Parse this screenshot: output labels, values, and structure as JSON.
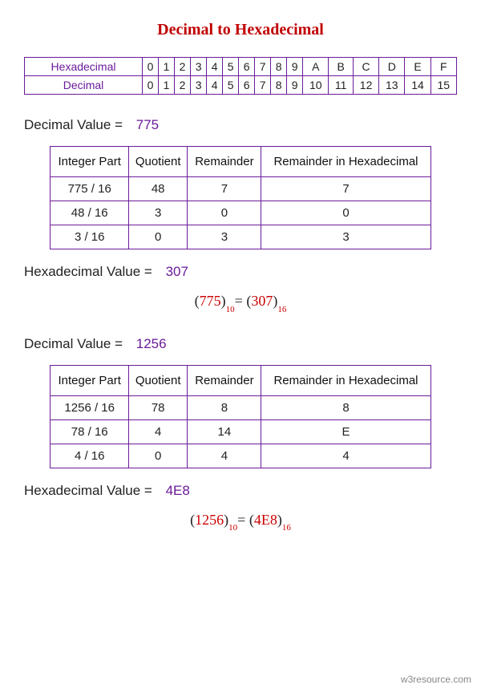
{
  "title": "Decimal to Hexadecimal",
  "ref": {
    "row1_label": "Hexadecimal",
    "row1": [
      "0",
      "1",
      "2",
      "3",
      "4",
      "5",
      "6",
      "7",
      "8",
      "9",
      "A",
      "B",
      "C",
      "D",
      "E",
      "F"
    ],
    "row2_label": "Decimal",
    "row2": [
      "0",
      "1",
      "2",
      "3",
      "4",
      "5",
      "6",
      "7",
      "8",
      "9",
      "10",
      "11",
      "12",
      "13",
      "14",
      "15"
    ]
  },
  "ex1": {
    "dec_label": "Decimal Value  =",
    "dec_value": "775",
    "headers": [
      "Integer Part",
      "Quotient",
      "Remainder",
      "Remainder  in Hexadecimal"
    ],
    "rows": [
      [
        "775 / 16",
        "48",
        "7",
        "7"
      ],
      [
        "48 / 16",
        "3",
        "0",
        "0"
      ],
      [
        "3 / 16",
        "0",
        "3",
        "3"
      ]
    ],
    "hex_label": "Hexadecimal Value  =",
    "hex_value": "307",
    "eq": {
      "dec": "775",
      "dbase": "10",
      "hex": "307",
      "hbase": "16"
    }
  },
  "ex2": {
    "dec_label": "Decimal Value  =",
    "dec_value": "1256",
    "headers": [
      "Integer Part",
      "Quotient",
      "Remainder",
      "Remainder  in Hexadecimal"
    ],
    "rows": [
      [
        "1256 / 16",
        "78",
        "8",
        "8"
      ],
      [
        "78 / 16",
        "4",
        "14",
        "E"
      ],
      [
        "4 / 16",
        "0",
        "4",
        "4"
      ]
    ],
    "hex_label": "Hexadecimal Value  =",
    "hex_value": "4E8",
    "eq": {
      "dec": "1256",
      "dbase": "10",
      "hex": "4E8",
      "hbase": "16"
    }
  },
  "footer": "w3resource.com",
  "chart_data": {
    "type": "table",
    "title": "Decimal to Hexadecimal conversion examples",
    "examples": [
      {
        "decimal": 775,
        "hexadecimal": "307",
        "steps": [
          {
            "divide": "775/16",
            "q": 48,
            "r": 7,
            "hex": "7"
          },
          {
            "divide": "48/16",
            "q": 3,
            "r": 0,
            "hex": "0"
          },
          {
            "divide": "3/16",
            "q": 0,
            "r": 3,
            "hex": "3"
          }
        ]
      },
      {
        "decimal": 1256,
        "hexadecimal": "4E8",
        "steps": [
          {
            "divide": "1256/16",
            "q": 78,
            "r": 8,
            "hex": "8"
          },
          {
            "divide": "78/16",
            "q": 4,
            "r": 14,
            "hex": "E"
          },
          {
            "divide": "4/16",
            "q": 0,
            "r": 4,
            "hex": "4"
          }
        ]
      }
    ],
    "hex_map": {
      "0": 0,
      "1": 1,
      "2": 2,
      "3": 3,
      "4": 4,
      "5": 5,
      "6": 6,
      "7": 7,
      "8": 8,
      "9": 9,
      "A": 10,
      "B": 11,
      "C": 12,
      "D": 13,
      "E": 14,
      "F": 15
    }
  }
}
